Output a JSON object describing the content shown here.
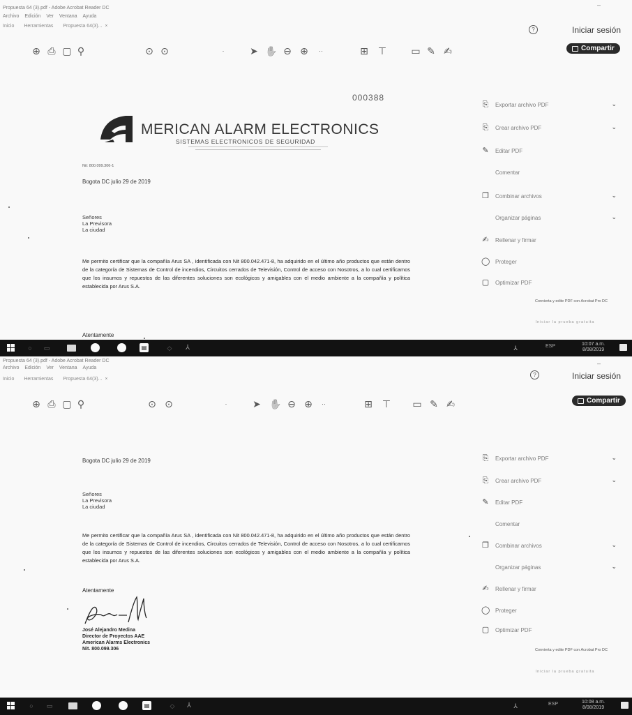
{
  "top_window": {
    "title": "Propuesta 64 (3).pdf - Adobe Acrobat Reader DC",
    "menu": [
      "Archivo",
      "Edición",
      "Ver",
      "Ventana",
      "Ayuda"
    ],
    "tabs": [
      "Inicio",
      "Herramientas",
      "Propuesta 64(3)..."
    ],
    "sign_in": "Iniciar sesión",
    "share_label": "Compartir",
    "doc_number": "000388",
    "logo_company": "MERICAN ALARM ELECTRONICS",
    "logo_tagline": "SISTEMAS ELECTRONICOS DE SEGURIDAD",
    "nit": "Nit: 800.099.306-1",
    "date": "Bogota DC julio 29 de 2019",
    "recipients": [
      "Señores",
      "La Previsora",
      "La ciudad"
    ],
    "body": "Me permito certificar que la compañía Arus SA , identificada con Nit 800.042.471-8, ha adquirido en el último año productos que están dentro de la categoría de Sistemas de Control de incendios, Circuitos cerrados de Televisión, Control de acceso con Nosotros, a lo cual certificamos que los insumos y repuestos de las diferentes soluciones son ecológicos y amigables con el medio ambiente a la compañía y política establecida por Arus S.A.",
    "closing": "Atentamente",
    "panel": [
      {
        "label": "Exportar archivo PDF",
        "chevron": true
      },
      {
        "label": "Crear archivo PDF",
        "chevron": true
      },
      {
        "label": "Editar PDF",
        "chevron": false
      },
      {
        "label": "Comentar",
        "chevron": false
      },
      {
        "label": "Combinar archivos",
        "chevron": true
      },
      {
        "label": "Organizar páginas",
        "chevron": true
      },
      {
        "label": "Rellenar y firmar",
        "chevron": false
      },
      {
        "label": "Proteger",
        "chevron": false
      },
      {
        "label": "Optimizar PDF",
        "chevron": false
      }
    ],
    "panel_note": "Convierta y edite PDF con Acrobat Pro DC",
    "panel_link": "Iniciar la prueba gratuita",
    "taskbar_tray": "ESP",
    "taskbar_clock": [
      "10:07 a.m.",
      "8/08/2019"
    ]
  },
  "bottom_window": {
    "title": "Propuesta 64 (3).pdf - Adobe Acrobat Reader DC",
    "menu": [
      "Archivo",
      "Edición",
      "Ver",
      "Ventana",
      "Ayuda"
    ],
    "tabs": [
      "Inicio",
      "Herramientas",
      "Propuesta 64(3)..."
    ],
    "sign_in": "Iniciar sesión",
    "share_label": "Compartir",
    "date": "Bogota DC julio 29 de 2019",
    "recipients": [
      "Señores",
      "La Previsora",
      "La ciudad"
    ],
    "body": "Me permito certificar que la compañía Arus SA , identificada con Nit 800.042.471-8, ha adquirido en el último año productos que están dentro de la categoría de Sistemas de Control de incendios, Circuitos cerrados de Televisión, Control de acceso con Nosotros, a lo cual certificamos que los insumos y repuestos de las diferentes soluciones son ecológicos y amigables con el medio ambiente a la compañía y política establecida por Arus S.A.",
    "closing": "Atentamente",
    "signer": [
      "José Alejandro Medina",
      "Director de Proyectos AAE",
      "American Alarms Electronics",
      "Nit. 800.099.306"
    ],
    "panel": [
      {
        "label": "Exportar archivo PDF",
        "chevron": true
      },
      {
        "label": "Crear archivo PDF",
        "chevron": true
      },
      {
        "label": "Editar PDF",
        "chevron": false
      },
      {
        "label": "Comentar",
        "chevron": false
      },
      {
        "label": "Combinar archivos",
        "chevron": true
      },
      {
        "label": "Organizar páginas",
        "chevron": true
      },
      {
        "label": "Rellenar y firmar",
        "chevron": false
      },
      {
        "label": "Proteger",
        "chevron": false
      },
      {
        "label": "Optimizar PDF",
        "chevron": false
      }
    ],
    "panel_note": "Convierta y edite PDF con Acrobat Pro DC",
    "panel_link": "Iniciar la prueba gratuita",
    "taskbar_tray": "ESP",
    "taskbar_clock": [
      "10:08 a.m.",
      "8/08/2019"
    ]
  },
  "icons": {
    "panel": [
      "export-pdf-icon",
      "create-pdf-icon",
      "edit-pdf-icon",
      "comment-icon",
      "combine-icon",
      "organize-icon",
      "fill-sign-icon",
      "protect-icon",
      "optimize-icon"
    ]
  }
}
